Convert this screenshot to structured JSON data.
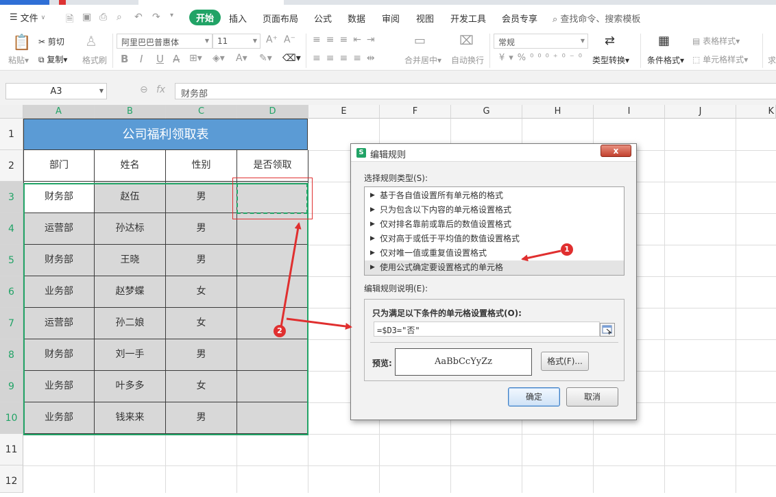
{
  "menu": {
    "file_label": "文件",
    "tabs": [
      "开始",
      "插入",
      "页面布局",
      "公式",
      "数据",
      "审阅",
      "视图",
      "开发工具",
      "会员专享"
    ],
    "search_placeholder": "查找命令、搜索模板"
  },
  "ribbon": {
    "cut": "剪切",
    "paste": "粘贴",
    "copy": "复制",
    "format_painter": "格式刷",
    "font_name": "阿里巴巴普惠体",
    "font_size": "11",
    "number_format": "常规",
    "merge_center": "合并居中",
    "wrap_text": "自动换行",
    "type_convert": "类型转换",
    "conditional_format": "条件格式",
    "table_style": "表格样式",
    "cell_style": "单元格样式",
    "sum": "求"
  },
  "formula_bar": {
    "name_box": "A3",
    "fx": "fx",
    "value": "财务部"
  },
  "sheet": {
    "columns": [
      "A",
      "B",
      "C",
      "D",
      "E",
      "F",
      "G",
      "H",
      "I",
      "J",
      "K"
    ],
    "rows": [
      "1",
      "2",
      "3",
      "4",
      "5",
      "6",
      "7",
      "8",
      "9",
      "10",
      "11",
      "12"
    ],
    "title": "公司福利领取表",
    "headers": [
      "部门",
      "姓名",
      "性别",
      "是否领取"
    ],
    "data": [
      [
        "财务部",
        "赵伍",
        "男",
        ""
      ],
      [
        "运营部",
        "孙达标",
        "男",
        ""
      ],
      [
        "财务部",
        "王晓",
        "男",
        ""
      ],
      [
        "业务部",
        "赵梦蝶",
        "女",
        ""
      ],
      [
        "运营部",
        "孙二娘",
        "女",
        ""
      ],
      [
        "财务部",
        "刘一手",
        "男",
        ""
      ],
      [
        "业务部",
        "叶多多",
        "女",
        ""
      ],
      [
        "业务部",
        "钱来来",
        "男",
        ""
      ]
    ]
  },
  "dialog": {
    "title": "编辑规则",
    "close": "x",
    "rule_type_label": "选择规则类型(S):",
    "rule_types": [
      "基于各自值设置所有单元格的格式",
      "只为包含以下内容的单元格设置格式",
      "仅对排名靠前或靠后的数值设置格式",
      "仅对高于或低于平均值的数值设置格式",
      "仅对唯一值或重复值设置格式",
      "使用公式确定要设置格式的单元格"
    ],
    "selected_rule_index": 5,
    "desc_label": "编辑规则说明(E):",
    "condition_label": "只为满足以下条件的单元格设置格式(O):",
    "formula": "=$D3=\"否\"",
    "preview_label": "预览:",
    "preview_text": "AaBbCcYyZz",
    "format_button": "格式(F)...",
    "ok": "确定",
    "cancel": "取消"
  },
  "annotations": {
    "badge1": "1",
    "badge2": "2",
    "color": "#e02f2f"
  },
  "colors": {
    "accent_green": "#21a366",
    "title_blue": "#5b9bd5",
    "cell_gray": "#d8d8d8"
  }
}
